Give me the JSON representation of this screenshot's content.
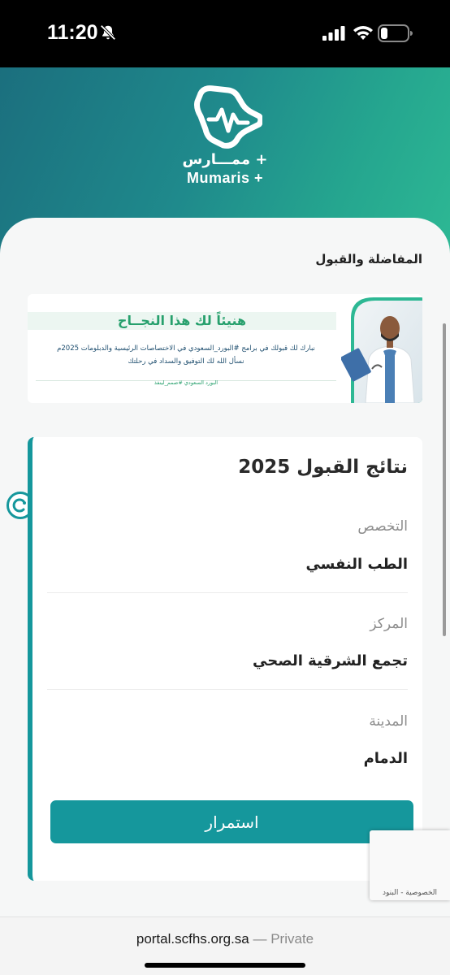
{
  "status_bar": {
    "time": "11:20",
    "icons": [
      "bell-slash-icon",
      "signal-icon",
      "wifi-icon",
      "battery-icon"
    ]
  },
  "header": {
    "logo_icon": "saudi-map-heartbeat-icon",
    "logo_ar": "ممـــارس +",
    "logo_en": "Mumaris +"
  },
  "section_title": "المفاضلة والقبول",
  "banner": {
    "headline": "هنيئاً لك هذا النجــاح",
    "line1": "نبارك لك قبولك في برامج #البورد_السعودي في الاختصاصات الرئيسية والدبلومات 2025م",
    "line2": "نسأل الله لك التوفيق والسداد في رحلتك",
    "hashtag": "البورد السعودي #صمم_لينفذ",
    "image": "doctor-photo"
  },
  "result_card": {
    "title": "نتائج القبول 2025",
    "fields": [
      {
        "label": "التخصص",
        "value": "الطب النفسي"
      },
      {
        "label": "المركز",
        "value": "تجمع الشرقية الصحي"
      },
      {
        "label": "المدينة",
        "value": "الدمام"
      }
    ],
    "continue_label": "استمرار"
  },
  "recaptcha": {
    "links": "الخصوصية - البنود"
  },
  "browser_bar": {
    "domain": "portal.scfhs.org.sa",
    "separator": " — ",
    "mode": "Private"
  },
  "colors": {
    "accent": "#15979c",
    "header_gradient_start": "#1b6f7e",
    "header_gradient_end": "#2db894",
    "banner_green": "#27a06d"
  }
}
